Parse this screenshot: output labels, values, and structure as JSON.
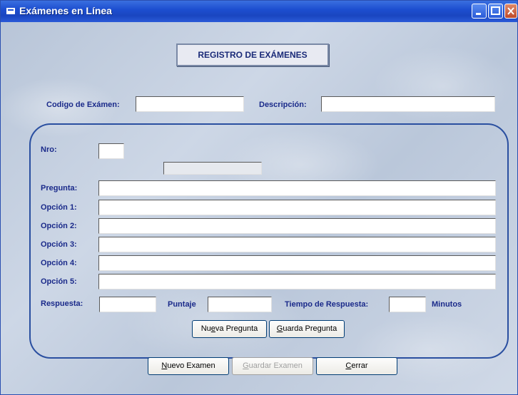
{
  "window": {
    "title": "Exámenes en Línea"
  },
  "header": {
    "title": "REGISTRO DE EXÁMENES"
  },
  "exam": {
    "code_label": "Codigo de Exámen:",
    "code_value": "",
    "description_label": "Descripción:",
    "description_value": ""
  },
  "question": {
    "nro_label": "Nro:",
    "nro_value": "",
    "status_value": "",
    "pregunta_label": "Pregunta:",
    "pregunta_value": "",
    "options": [
      {
        "label": "Opción 1:",
        "value": ""
      },
      {
        "label": "Opción 2:",
        "value": ""
      },
      {
        "label": "Opción 3:",
        "value": ""
      },
      {
        "label": "Opción 4:",
        "value": ""
      },
      {
        "label": "Opción 5:",
        "value": ""
      }
    ],
    "respuesta_label": "Respuesta:",
    "respuesta_value": "",
    "puntaje_label": "Puntaje",
    "puntaje_value": "",
    "tiempo_label": "Tiempo de Respuesta:",
    "tiempo_value": "",
    "minutos_label": "Minutos"
  },
  "buttons": {
    "nueva_pregunta": {
      "pre": "Nu",
      "key": "e",
      "post": "va Pregunta"
    },
    "guarda_pregunta": {
      "pre": "",
      "key": "G",
      "post": "uarda Pregunta"
    },
    "nuevo_examen": {
      "pre": "",
      "key": "N",
      "post": "uevo Examen"
    },
    "guardar_examen": {
      "pre": "",
      "key": "G",
      "post": "uardar Examen"
    },
    "cerrar": {
      "pre": "",
      "key": "C",
      "post": "errar"
    }
  }
}
